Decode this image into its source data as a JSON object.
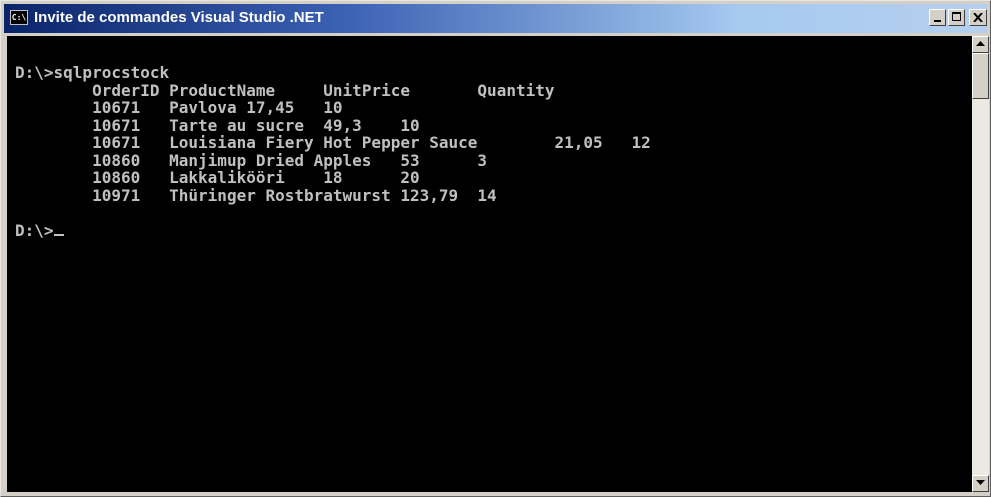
{
  "window": {
    "title": "Invite de commandes Visual Studio .NET",
    "icon_label": "C:\\"
  },
  "console": {
    "prompt_command": "D:\\>sqlprocstock",
    "header": {
      "order_id": "OrderID",
      "product_name": "ProductName",
      "unit_price": "UnitPrice",
      "quantity": "Quantity"
    },
    "rows": [
      {
        "order_id": "10671",
        "product_name": "Pavlova",
        "unit_price": "17,45",
        "quantity": "10"
      },
      {
        "order_id": "10671",
        "product_name": "Tarte au sucre",
        "unit_price": "49,3",
        "quantity": "10"
      },
      {
        "order_id": "10671",
        "product_name": "Louisiana Fiery Hot Pepper Sauce",
        "unit_price": "21,05",
        "quantity": "12"
      },
      {
        "order_id": "10860",
        "product_name": "Manjimup Dried Apples",
        "unit_price": "53",
        "quantity": "3"
      },
      {
        "order_id": "10860",
        "product_name": "Lakkalikööri",
        "unit_price": "18",
        "quantity": "20"
      },
      {
        "order_id": "10971",
        "product_name": "Thüringer Rostbratwurst",
        "unit_price": "123,79",
        "quantity": "14"
      }
    ],
    "final_prompt": "D:\\>"
  },
  "icons": {
    "app": "console-icon",
    "minimize": "minimize-icon",
    "maximize": "maximize-icon",
    "close": "close-icon",
    "scroll_up": "arrow-up-icon",
    "scroll_down": "arrow-down-icon"
  },
  "colors": {
    "console_bg": "#000000",
    "console_fg": "#c0c0c0",
    "title_start": "#0a246a",
    "title_end": "#a6caf0"
  }
}
